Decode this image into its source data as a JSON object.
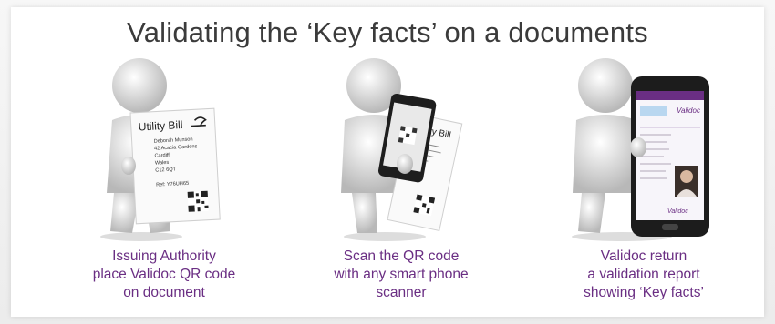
{
  "title": "Validating the ‘Key facts’ on a documents",
  "steps": [
    {
      "caption": [
        "Issuing Authority",
        "place Validoc QR code",
        "on document"
      ],
      "bill": {
        "heading": "Utility Bill",
        "lines": [
          "Deborah Munson",
          "42 Acacia Gardens",
          "Cardiff",
          "Wales",
          "C12 6QT"
        ],
        "ref": "Ref: Y76UH65"
      }
    },
    {
      "caption": [
        "Scan the QR code",
        "with any smart phone",
        "scanner"
      ],
      "bill": {
        "heading": "Utility Bill"
      }
    },
    {
      "caption": [
        "Validoc return",
        "a validation report",
        "showing ‘Key facts’"
      ],
      "phone": {
        "brand": "Validoc",
        "footer_brand": "Validoc"
      }
    }
  ],
  "colors": {
    "caption": "#6a2e83",
    "title": "#3b3b3b",
    "accent": "#7b3a96"
  }
}
